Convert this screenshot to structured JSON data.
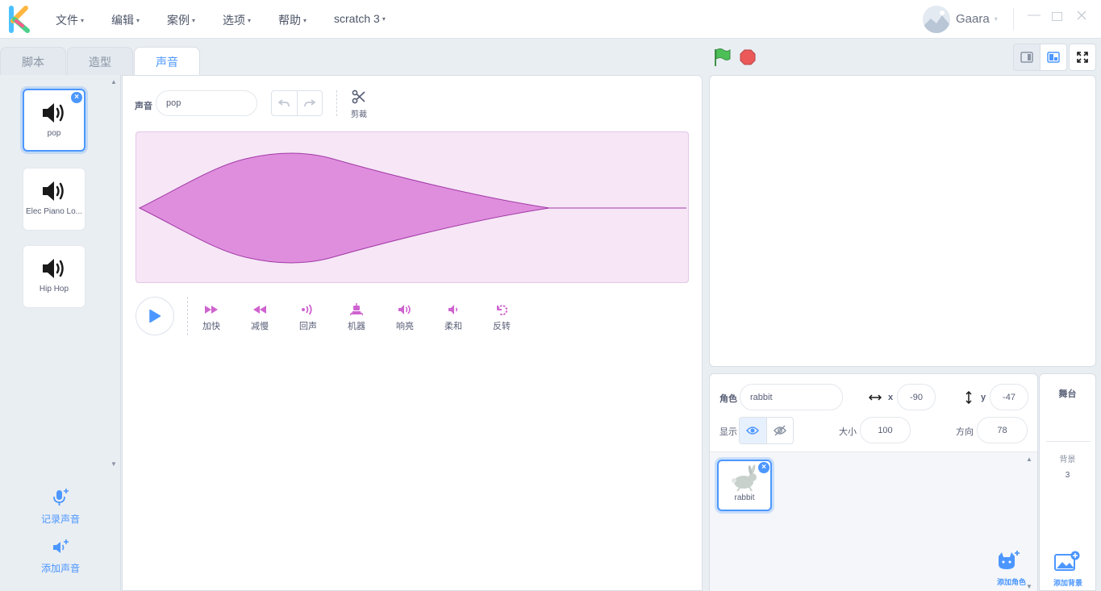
{
  "menu": {
    "items": [
      "文件",
      "编辑",
      "案例",
      "选项",
      "帮助",
      "scratch 3"
    ],
    "username": "Gaara"
  },
  "tabs": [
    "脚本",
    "造型",
    "声音"
  ],
  "active_tab": 2,
  "sounds": [
    {
      "name": "pop",
      "selected": true
    },
    {
      "name": "Elec Piano Lo...",
      "selected": false
    },
    {
      "name": "Hip Hop",
      "selected": false
    }
  ],
  "sound_actions": {
    "record": "记录声音",
    "add": "添加声音"
  },
  "editor": {
    "sound_label": "声音",
    "sound_name": "pop",
    "trim_label": "剪裁",
    "effects": [
      "加快",
      "减慢",
      "回声",
      "机器",
      "响亮",
      "柔和",
      "反转"
    ]
  },
  "sprite_info": {
    "sprite_label": "角色",
    "sprite_name": "rabbit",
    "x_label": "x",
    "x_value": "-90",
    "y_label": "y",
    "y_value": "-47",
    "show_label": "显示",
    "size_label": "大小",
    "size_value": "100",
    "direction_label": "方向",
    "direction_value": "78",
    "sprites": [
      {
        "name": "rabbit"
      }
    ],
    "add_sprite_label": "添加角色"
  },
  "stage_pane": {
    "title": "舞台",
    "backdrops_label": "背景",
    "backdrops_count": "3",
    "add_backdrop_label": "添加背景"
  },
  "colors": {
    "accent": "#4c97ff",
    "sound_purple": "#cf63cf",
    "wave_fill": "#df8ede",
    "flag_green": "#4cbf56",
    "stop_red": "#ec5959"
  }
}
